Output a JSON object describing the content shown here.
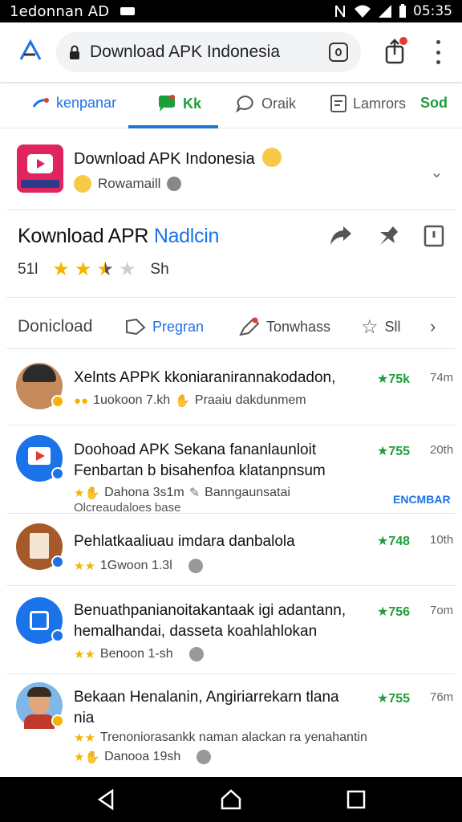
{
  "status_bar": {
    "carrier": "1edonnan AD",
    "time": "05:35"
  },
  "address_bar": {
    "url_text": "Download APK Indonesia",
    "tab_count": "0"
  },
  "top_tabs": [
    {
      "label": "kenpanar"
    },
    {
      "label": "Kk"
    },
    {
      "label": "Oraik"
    },
    {
      "label": "Lamrors"
    },
    {
      "label": "Sod"
    }
  ],
  "app_card": {
    "title": "Download APK Indonesia",
    "subtitle": "Rowamaill"
  },
  "headline": {
    "part1": "Kownload APR ",
    "part2": "Nadlcin"
  },
  "rating": {
    "left": "51l",
    "stars": 2.5,
    "right": "Sh"
  },
  "sub_nav": {
    "first": "Donicload",
    "items": [
      {
        "label": "Pregran"
      },
      {
        "label": "Tonwhass"
      },
      {
        "label": "Sll"
      }
    ]
  },
  "list": [
    {
      "title": "Xelnts APPK kkoniaranirannakodadon,",
      "meta": "1uokoon 7.kh",
      "meta_extra": "Praaiu dakdunmem",
      "score": "★75k",
      "time": "74m"
    },
    {
      "title": "Doohoad APK Sekana fananlaunloit",
      "title2": "Fenbartan b bisahenfoa klatanpnsum",
      "meta": "Dahona 3s1m",
      "meta_extra": "Banngaunsatai",
      "meta2": "Olcreaudaloes base",
      "score": "★755",
      "time": "20th",
      "link": "ENCMBAR"
    },
    {
      "title": "Pehlatkaaliuau imdara danbalola",
      "meta": "1Gwoon 1.3l",
      "score": "★748",
      "time": "10th"
    },
    {
      "title": "Benuathpanianoitakantaak igi adantann,",
      "title2": "hemalhandai, dasseta koahlahlokan",
      "meta": "Benoon 1-sh",
      "score": "★756",
      "time": "7om"
    },
    {
      "title": "Bekaan Henalanin, Angiriarrekarn tlana",
      "title2": "nia",
      "meta": "Trenoniorasankk naman alackan ra yenahantin",
      "meta2": "Danooa 19sh",
      "score": "★755",
      "time": "76m"
    }
  ],
  "colors": {
    "accent_blue": "#1a73e8",
    "score_green": "#1e9e3a",
    "star_gold": "#f5b400",
    "app_icon_red": "#e0245e"
  }
}
